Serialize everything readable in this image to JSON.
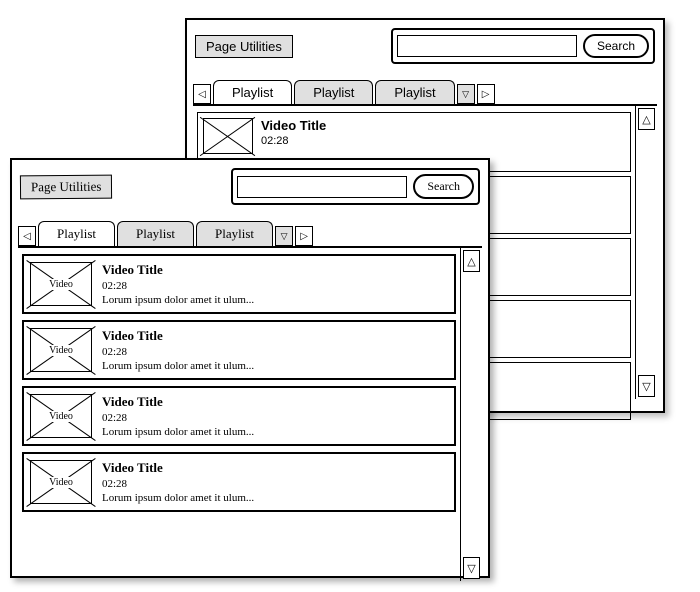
{
  "back": {
    "page_util": "Page Utilities",
    "search_placeholder": "",
    "search_btn": "Search",
    "tabs": [
      "Playlist",
      "Playlist",
      "Playlist"
    ],
    "item": {
      "title": "Video Title",
      "time": "02:28"
    }
  },
  "front": {
    "page_util": "Page Utilities",
    "search_placeholder": "",
    "search_btn": "Search",
    "tabs": [
      "Playlist",
      "Playlist",
      "Playlist"
    ],
    "items": [
      {
        "thumb": "Video",
        "title": "Video Title",
        "time": "02:28",
        "desc": "Lorum ipsum dolor amet it ulum..."
      },
      {
        "thumb": "Video",
        "title": "Video Title",
        "time": "02:28",
        "desc": "Lorum ipsum dolor amet it ulum..."
      },
      {
        "thumb": "Video",
        "title": "Video Title",
        "time": "02:28",
        "desc": "Lorum ipsum dolor amet it ulum..."
      },
      {
        "thumb": "Video",
        "title": "Video Title",
        "time": "02:28",
        "desc": "Lorum ipsum dolor amet it ulum..."
      }
    ]
  }
}
